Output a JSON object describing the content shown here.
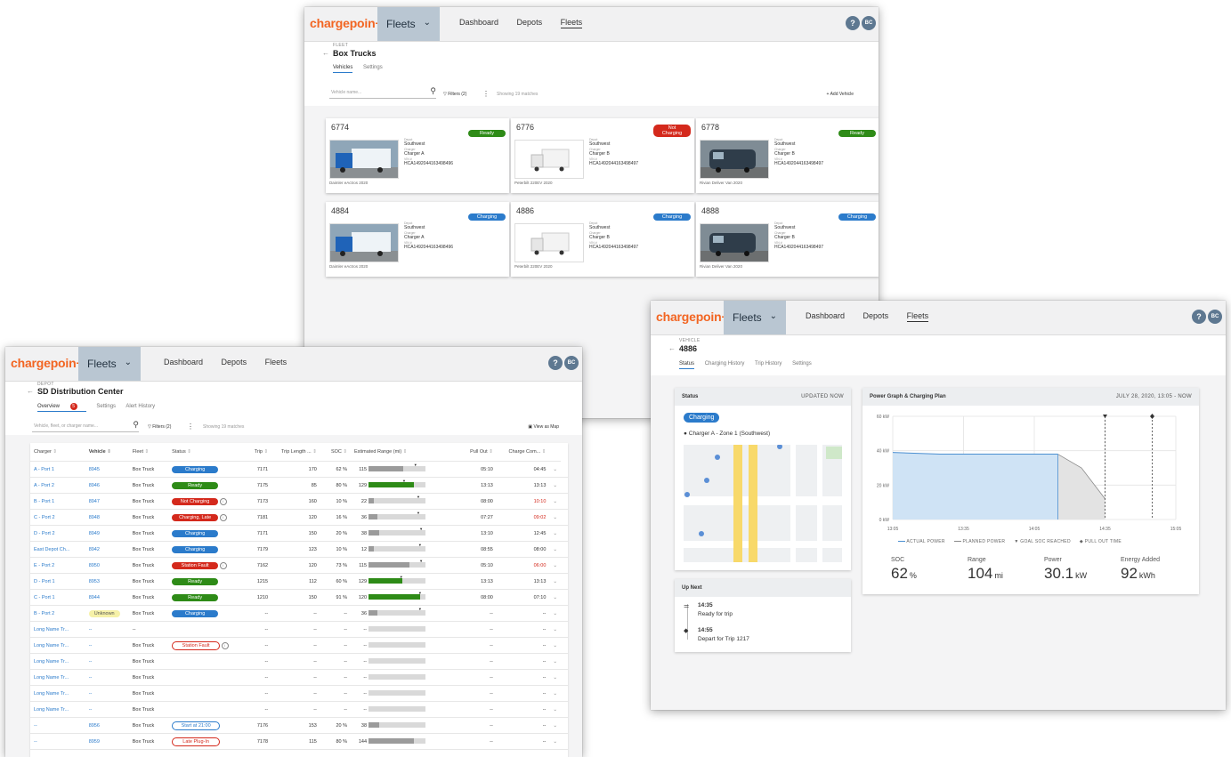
{
  "brand": "chargepoin+",
  "nav": {
    "fleet_selector": "Fleets",
    "dashboard": "Dashboard",
    "depots": "Depots",
    "fleets": "Fleets",
    "help": "?",
    "user_initials": "BC"
  },
  "fleet_window": {
    "crumb": "FLEET",
    "title": "Box Trucks",
    "tabs": [
      "Vehicles",
      "Settings"
    ],
    "search_placeholder": "Vehicle name...",
    "filters": "Filters (2)",
    "showing": "Showing 19 matches",
    "add_vehicle": "Add Vehicle",
    "cards": [
      {
        "id": "6774",
        "status": "Ready",
        "kind": "ready",
        "depot_label": "Depot",
        "depot": "Southwest",
        "charger_label": "Charger",
        "charger": "Charger A",
        "vin_label": "VIN #",
        "vin": "HCA1492044163498496",
        "model": "Daimler eActros 2020",
        "img": "blue"
      },
      {
        "id": "6776",
        "status": "Not Charging",
        "kind": "not",
        "depot_label": "Depot",
        "depot": "Southwest",
        "charger_label": "Charger",
        "charger": "Charger B",
        "vin_label": "VIN #",
        "vin": "HCA1492044163498497",
        "model": "Peterbilt 220EV 2020",
        "img": "white"
      },
      {
        "id": "6778",
        "status": "Ready",
        "kind": "ready",
        "depot_label": "Depot",
        "depot": "Southwest",
        "charger_label": "Charger",
        "charger": "Charger B",
        "vin_label": "VIN #",
        "vin": "HCA1492044163498497",
        "model": "Rivian Deliver Van 2020",
        "img": "van"
      },
      {
        "id": "4884",
        "status": "Charging",
        "kind": "charging",
        "depot_label": "Depot",
        "depot": "Southwest",
        "charger_label": "Charger",
        "charger": "Charger A",
        "vin_label": "VIN #",
        "vin": "HCA1492044163498496",
        "model": "Daimler eActros 2020",
        "img": "blue"
      },
      {
        "id": "4886",
        "status": "Charging",
        "kind": "charging",
        "depot_label": "Depot",
        "depot": "Southwest",
        "charger_label": "Charger",
        "charger": "Charger B",
        "vin_label": "VIN #",
        "vin": "HCA1492044163498497",
        "model": "Peterbilt 220EV 2020",
        "img": "white"
      },
      {
        "id": "4888",
        "status": "Charging",
        "kind": "charging",
        "depot_label": "Depot",
        "depot": "Southwest",
        "charger_label": "Charger",
        "charger": "Charger B",
        "vin_label": "VIN #",
        "vin": "HCA1492044163498497",
        "model": "Rivian Deliver Van 2020",
        "img": "van"
      }
    ]
  },
  "depot_window": {
    "crumb": "DEPOT",
    "title": "SD Distribution Center",
    "tabs": [
      "Overview",
      "Settings",
      "Alert History"
    ],
    "overview_count": "5",
    "search_placeholder": "Vehicle, fleet, or charger name...",
    "filters": "Filters (2)",
    "showing": "Showing 19 matches",
    "view_map": "View as Map",
    "columns": [
      "Charger",
      "Vehicle",
      "Fleet",
      "Status",
      "Trip",
      "Trip Length ...",
      "SOC",
      "Estimated Range (mi)",
      "Pull Out",
      "Charge Com..."
    ],
    "rows": [
      {
        "charger": "A - Port 1",
        "vehicle": "8945",
        "fleet": "Box Truck",
        "status": "Charging",
        "kind": "charging",
        "info": false,
        "trip": "7171",
        "len": "170",
        "soc": "62 %",
        "range": "115",
        "fill": 0.62,
        "fc": "gr",
        "mark": 0.8,
        "pull": "05:10",
        "charge": "04:45",
        "cred": false
      },
      {
        "charger": "A - Port 2",
        "vehicle": "8946",
        "fleet": "Box Truck",
        "status": "Ready",
        "kind": "ready",
        "info": false,
        "trip": "7175",
        "len": "85",
        "soc": "80 %",
        "range": "129",
        "fill": 0.8,
        "fc": "g",
        "mark": 0.6,
        "pull": "13:13",
        "charge": "13:13",
        "cred": false
      },
      {
        "charger": "B - Port 1",
        "vehicle": "8947",
        "fleet": "Box Truck",
        "status": "Not Charging",
        "kind": "not",
        "info": true,
        "trip": "7173",
        "len": "160",
        "soc": "10 %",
        "range": "22",
        "fill": 0.1,
        "fc": "gr",
        "mark": 0.85,
        "pull": "08:00",
        "charge": "10:10",
        "cred": true
      },
      {
        "charger": "C - Port 2",
        "vehicle": "8948",
        "fleet": "Box Truck",
        "status": "Charging, Late",
        "kind": "late",
        "info": true,
        "trip": "7181",
        "len": "120",
        "soc": "16 %",
        "range": "36",
        "fill": 0.16,
        "fc": "gr",
        "mark": 0.85,
        "pull": "07:27",
        "charge": "09:02",
        "cred": true
      },
      {
        "charger": "D - Port 2",
        "vehicle": "8949",
        "fleet": "Box Truck",
        "status": "Charging",
        "kind": "charging",
        "info": false,
        "trip": "7171",
        "len": "150",
        "soc": "20 %",
        "range": "38",
        "fill": 0.2,
        "fc": "gr",
        "mark": 0.9,
        "pull": "13:10",
        "charge": "12:45",
        "cred": false
      },
      {
        "charger": "East Depot Ch...",
        "vehicle": "8942",
        "fleet": "Box Truck",
        "status": "Charging",
        "kind": "charging",
        "info": false,
        "trip": "7179",
        "len": "123",
        "soc": "10 %",
        "range": "12",
        "fill": 0.1,
        "fc": "gr",
        "mark": 0.88,
        "pull": "08:55",
        "charge": "08:00",
        "cred": false
      },
      {
        "charger": "E - Port 2",
        "vehicle": "8950",
        "fleet": "Box Truck",
        "status": "Station Fault",
        "kind": "fault",
        "info": true,
        "trip": "7162",
        "len": "120",
        "soc": "73 %",
        "range": "115",
        "fill": 0.73,
        "fc": "gr",
        "mark": 0.9,
        "pull": "05:10",
        "charge": "06:00",
        "cred": true
      },
      {
        "charger": "D - Port 1",
        "vehicle": "8953",
        "fleet": "Box Truck",
        "status": "Ready",
        "kind": "ready",
        "info": false,
        "trip": "1215",
        "len": "112",
        "soc": "60 %",
        "range": "129",
        "fill": 0.6,
        "fc": "g",
        "mark": 0.55,
        "pull": "13:13",
        "charge": "13:13",
        "cred": false
      },
      {
        "charger": "C - Port 1",
        "vehicle": "8944",
        "fleet": "Box Truck",
        "status": "Ready",
        "kind": "ready",
        "info": false,
        "trip": "1210",
        "len": "150",
        "soc": "91 %",
        "range": "120",
        "fill": 0.91,
        "fc": "g",
        "mark": 0.88,
        "pull": "08:00",
        "charge": "07:10",
        "cred": false
      },
      {
        "charger": "B - Port 2",
        "vehicle": "Unknown",
        "fleet": "Box Truck",
        "status": "Charging",
        "kind": "charging",
        "info": false,
        "trip": "--",
        "len": "--",
        "soc": "--",
        "range": "36",
        "fill": 0.16,
        "fc": "gr",
        "mark": 0.88,
        "pull": "--",
        "charge": "--",
        "cred": false
      },
      {
        "charger": "Long Name Tr...",
        "vehicle": "--",
        "fleet": "--",
        "status": "",
        "kind": "",
        "info": false,
        "trip": "--",
        "len": "--",
        "soc": "--",
        "range": "--",
        "fill": 0,
        "fc": "gr",
        "mark": -1,
        "pull": "--",
        "charge": "--",
        "cred": false
      },
      {
        "charger": "Long Name Tr...",
        "vehicle": "--",
        "fleet": "Box Truck",
        "status": "Station Fault",
        "kind": "outline-red",
        "info": true,
        "trip": "--",
        "len": "--",
        "soc": "--",
        "range": "--",
        "fill": 0,
        "fc": "gr",
        "mark": -1,
        "pull": "--",
        "charge": "--",
        "cred": false
      },
      {
        "charger": "Long Name Tr...",
        "vehicle": "--",
        "fleet": "Box Truck",
        "status": "",
        "kind": "",
        "info": false,
        "trip": "--",
        "len": "--",
        "soc": "--",
        "range": "--",
        "fill": 0,
        "fc": "gr",
        "mark": -1,
        "pull": "--",
        "charge": "--",
        "cred": false
      },
      {
        "charger": "Long Name Tr...",
        "vehicle": "--",
        "fleet": "Box Truck",
        "status": "",
        "kind": "",
        "info": false,
        "trip": "--",
        "len": "--",
        "soc": "--",
        "range": "--",
        "fill": 0,
        "fc": "gr",
        "mark": -1,
        "pull": "--",
        "charge": "--",
        "cred": false
      },
      {
        "charger": "Long Name Tr...",
        "vehicle": "--",
        "fleet": "Box Truck",
        "status": "",
        "kind": "",
        "info": false,
        "trip": "--",
        "len": "--",
        "soc": "--",
        "range": "--",
        "fill": 0,
        "fc": "gr",
        "mark": -1,
        "pull": "--",
        "charge": "--",
        "cred": false
      },
      {
        "charger": "Long Name Tr...",
        "vehicle": "--",
        "fleet": "Box Truck",
        "status": "",
        "kind": "",
        "info": false,
        "trip": "--",
        "len": "--",
        "soc": "--",
        "range": "--",
        "fill": 0,
        "fc": "gr",
        "mark": -1,
        "pull": "--",
        "charge": "--",
        "cred": false
      },
      {
        "charger": "--",
        "vehicle": "8956",
        "fleet": "Box Truck",
        "status": "Start at 21:00",
        "kind": "outline",
        "info": false,
        "trip": "7176",
        "len": "153",
        "soc": "20 %",
        "range": "38",
        "fill": 0.2,
        "fc": "gr",
        "mark": -1,
        "pull": "--",
        "charge": "--",
        "cred": false
      },
      {
        "charger": "--",
        "vehicle": "8959",
        "fleet": "Box Truck",
        "status": "Late Plug-In",
        "kind": "outline-red",
        "info": false,
        "trip": "7178",
        "len": "115",
        "soc": "80 %",
        "range": "144",
        "fill": 0.8,
        "fc": "gr",
        "mark": -1,
        "pull": "--",
        "charge": "--",
        "cred": false
      }
    ]
  },
  "vehicle_window": {
    "crumb": "VEHICLE",
    "title": "4886",
    "tabs": [
      "Status",
      "Charging History",
      "Trip History",
      "Settings"
    ],
    "status_panel": {
      "title": "Status",
      "updated": "UPDATED NOW",
      "badge": "Charging",
      "location": "Charger A - Zone 1 (Southwest)"
    },
    "graph_panel": {
      "title": "Power Graph & Charging Plan",
      "date": "JULY 28, 2020, 13:05 - NOW"
    },
    "legend": [
      "ACTUAL POWER",
      "PLANNED POWER",
      "GOAL SOC REACHED",
      "PULL OUT TIME"
    ],
    "stats": [
      {
        "label": "SOC",
        "value": "62",
        "unit": "%"
      },
      {
        "label": "Range",
        "value": "104",
        "unit": "mi"
      },
      {
        "label": "Power",
        "value": "30.1",
        "unit": "kW"
      },
      {
        "label": "Energy Added",
        "value": "92",
        "unit": "kWh"
      }
    ],
    "up_next": {
      "title": "Up Next",
      "items": [
        {
          "time": "14:35",
          "text": "Ready for trip"
        },
        {
          "time": "14:55",
          "text": "Depart for Trip 1217"
        }
      ]
    }
  },
  "chart_data": {
    "type": "area",
    "x": [
      "13:05",
      "13:25",
      "13:45",
      "14:05",
      "14:15",
      "14:25",
      "14:35",
      "14:55",
      "15:05"
    ],
    "xticks": [
      "13:05",
      "13:35",
      "14:05",
      "14:35",
      "15:05"
    ],
    "yticks": [
      "0 kW",
      "20 kW",
      "40 kW",
      "60 kW"
    ],
    "ylim": [
      0,
      60
    ],
    "series": [
      {
        "name": "ACTUAL POWER",
        "values": [
          39,
          38,
          38,
          38,
          38,
          null,
          null,
          null,
          null
        ]
      },
      {
        "name": "PLANNED POWER",
        "values": [
          null,
          null,
          null,
          null,
          38,
          30,
          12,
          null,
          null
        ]
      }
    ],
    "markers": [
      {
        "name": "GOAL SOC REACHED",
        "x": "14:35"
      },
      {
        "name": "PULL OUT TIME",
        "x": "14:55"
      }
    ],
    "colors": {
      "actual": "#cfe3f5",
      "actual_line": "#4b8fd1",
      "planned": "#e3e3e3",
      "planned_line": "#8a8a8a"
    }
  }
}
